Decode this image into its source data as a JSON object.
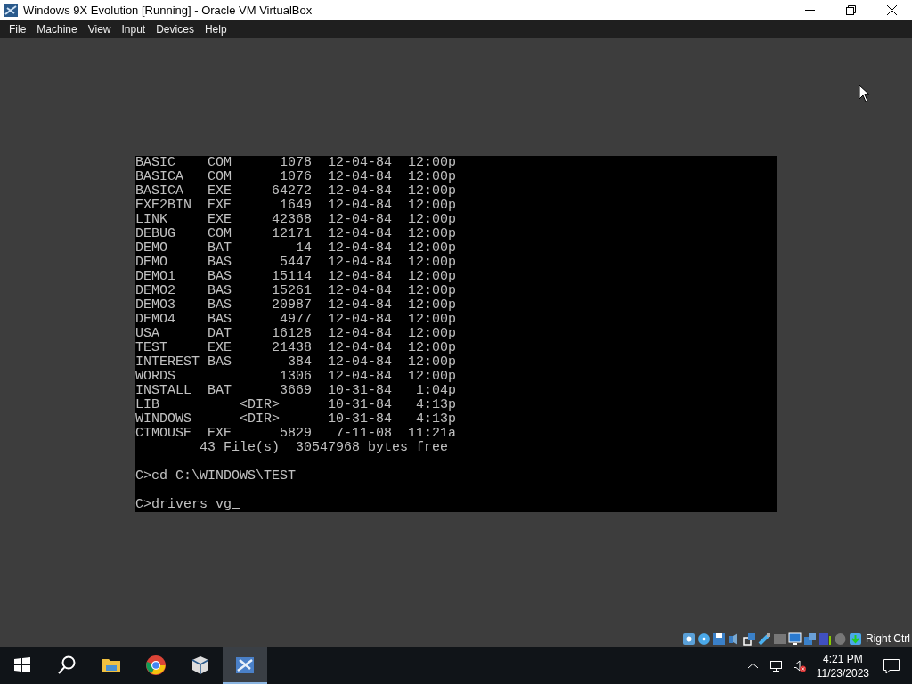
{
  "window": {
    "title": "Windows 9X Evolution [Running] - Oracle VM VirtualBox"
  },
  "menu": [
    "File",
    "Machine",
    "View",
    "Input",
    "Devices",
    "Help"
  ],
  "console": {
    "lines": [
      {
        "kind": "output",
        "text": "BASIC    COM      1078  12-04-84  12:00p"
      },
      {
        "kind": "output",
        "text": "BASICA   COM      1076  12-04-84  12:00p"
      },
      {
        "kind": "output",
        "text": "BASICA   EXE     64272  12-04-84  12:00p"
      },
      {
        "kind": "output",
        "text": "EXE2BIN  EXE      1649  12-04-84  12:00p"
      },
      {
        "kind": "output",
        "text": "LINK     EXE     42368  12-04-84  12:00p"
      },
      {
        "kind": "output",
        "text": "DEBUG    COM     12171  12-04-84  12:00p"
      },
      {
        "kind": "output",
        "text": "DEMO     BAT        14  12-04-84  12:00p"
      },
      {
        "kind": "output",
        "text": "DEMO     BAS      5447  12-04-84  12:00p"
      },
      {
        "kind": "output",
        "text": "DEMO1    BAS     15114  12-04-84  12:00p"
      },
      {
        "kind": "output",
        "text": "DEMO2    BAS     15261  12-04-84  12:00p"
      },
      {
        "kind": "output",
        "text": "DEMO3    BAS     20987  12-04-84  12:00p"
      },
      {
        "kind": "output",
        "text": "DEMO4    BAS      4977  12-04-84  12:00p"
      },
      {
        "kind": "output",
        "text": "USA      DAT     16128  12-04-84  12:00p"
      },
      {
        "kind": "output",
        "text": "TEST     EXE     21438  12-04-84  12:00p"
      },
      {
        "kind": "output",
        "text": "INTEREST BAS       384  12-04-84  12:00p"
      },
      {
        "kind": "output",
        "text": "WORDS             1306  12-04-84  12:00p"
      },
      {
        "kind": "output",
        "text": "INSTALL  BAT      3669  10-31-84   1:04p"
      },
      {
        "kind": "output",
        "text": "LIB          <DIR>      10-31-84   4:13p"
      },
      {
        "kind": "output",
        "text": "WINDOWS      <DIR>      10-31-84   4:13p"
      },
      {
        "kind": "output",
        "text": "CTMOUSE  EXE      5829   7-11-08  11:21a"
      },
      {
        "kind": "output",
        "text": "        43 File(s)  30547968 bytes free"
      },
      {
        "kind": "command",
        "text": "C>cd C:\\WINDOWS\\TEST"
      },
      {
        "kind": "command",
        "text": "C>drivers vg",
        "cursor": true
      }
    ]
  },
  "status_bar": {
    "hint": "Right Ctrl"
  },
  "taskbar": {
    "apps": [
      {
        "kind": "folder",
        "selected": false
      },
      {
        "kind": "browser",
        "selected": false
      },
      {
        "kind": "cube",
        "selected": false
      },
      {
        "kind": "vm",
        "selected": true
      }
    ],
    "time": "4:21 PM",
    "date": "11/23/2023"
  }
}
